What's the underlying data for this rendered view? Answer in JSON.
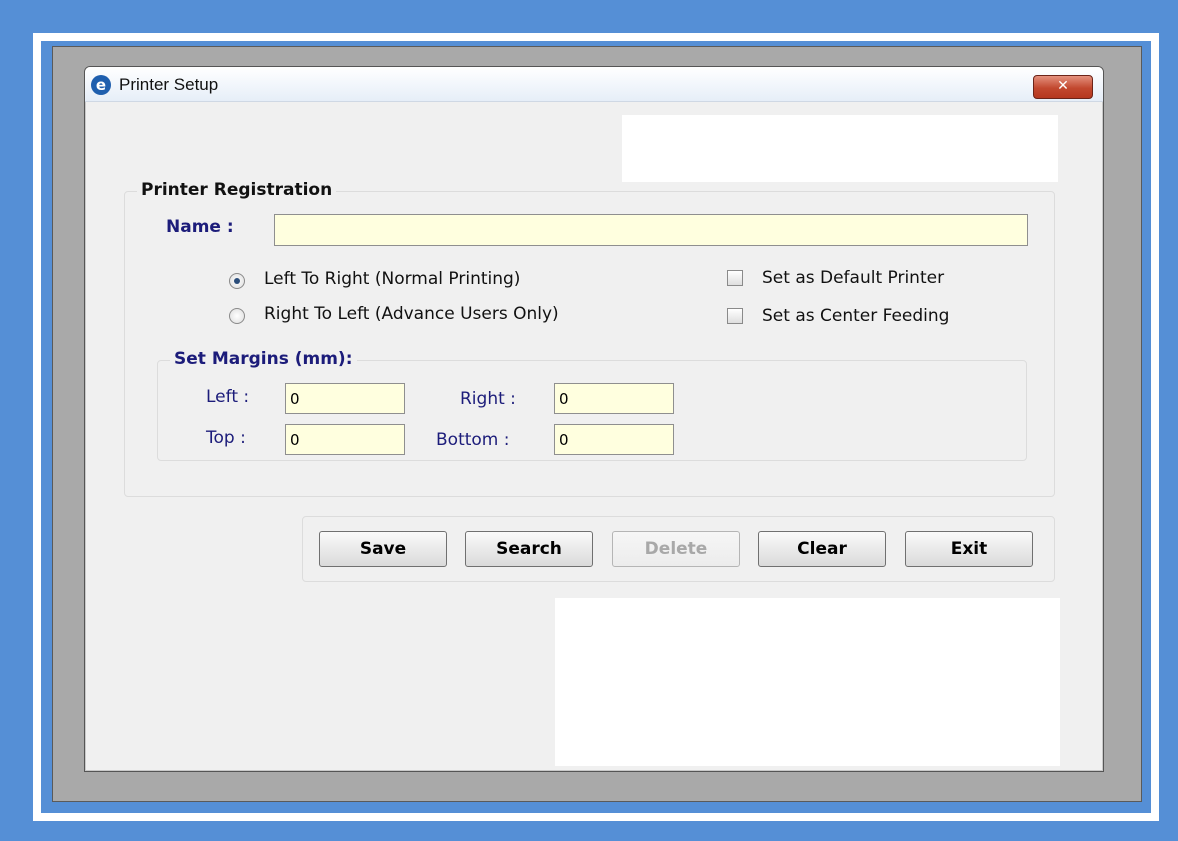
{
  "window": {
    "title": "Printer Setup",
    "close_label": "✕"
  },
  "registration": {
    "group_title": "Printer Registration",
    "name_label": "Name :",
    "name_value": "",
    "radio_ltr": "Left To Right (Normal Printing)",
    "radio_rtl": "Right To Left (Advance Users Only)",
    "radio_selected": "ltr",
    "check_default": "Set as Default Printer",
    "check_center": "Set as Center Feeding"
  },
  "margins": {
    "group_title": "Set Margins (mm):",
    "left_label": "Left :",
    "left_value": "0",
    "right_label": "Right :",
    "right_value": "0",
    "top_label": "Top :",
    "top_value": "0",
    "bottom_label": "Bottom :",
    "bottom_value": "0"
  },
  "buttons": {
    "save": "Save",
    "search": "Search",
    "delete": "Delete",
    "clear": "Clear",
    "exit": "Exit"
  },
  "colors": {
    "background": "#558fd6",
    "input_fill": "#ffffdf",
    "label_blue": "#1c1c7a",
    "close_red": "#c2482f"
  }
}
